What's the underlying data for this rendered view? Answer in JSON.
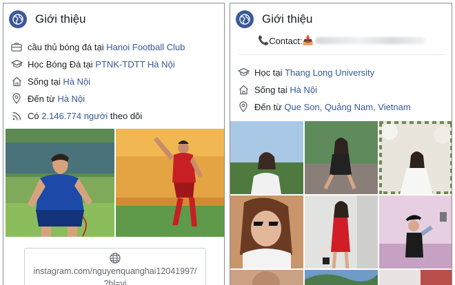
{
  "left_panel": {
    "title": "Giới thiệu",
    "work": {
      "prefix": "cầu thủ bóng đá tại",
      "place": "Hanoi Football Club",
      "icon": "briefcase-icon"
    },
    "education": {
      "prefix": "Học Bóng Đá tại",
      "place": "PTNK-TDTT Hà Nội",
      "icon": "graduation-cap-icon"
    },
    "lives": {
      "prefix": "Sống tại",
      "place": "Hà Nội",
      "icon": "home-icon"
    },
    "from": {
      "prefix": "Đến từ",
      "place": "Hà Nội",
      "icon": "location-pin-icon"
    },
    "followers": {
      "prefix": "Có",
      "count": "2.146.774 người",
      "suffix": "theo dõi",
      "icon": "rss-icon"
    },
    "website": {
      "line1": "instagram.com/nguyenquanghai12041997/",
      "line2": "?hl=vi",
      "icon": "globe-icon"
    }
  },
  "right_panel": {
    "title": "Giới thiệu",
    "contact": {
      "emoji": "📞",
      "label": "Contact:",
      "flag_emoji": "📥"
    },
    "education": {
      "prefix": "Học tại",
      "place": "Thang Long University",
      "icon": "graduation-cap-icon"
    },
    "lives": {
      "prefix": "Sống tại",
      "place": "Hà Nội",
      "icon": "home-icon"
    },
    "from": {
      "prefix": "Đến từ",
      "place": "Que Son, Quảng Nam, Vietnam",
      "icon": "location-pin-icon"
    }
  },
  "colors": {
    "link": "#365899",
    "badge": "#3b5998",
    "text": "#1c1e21",
    "border": "#8a8d91"
  }
}
